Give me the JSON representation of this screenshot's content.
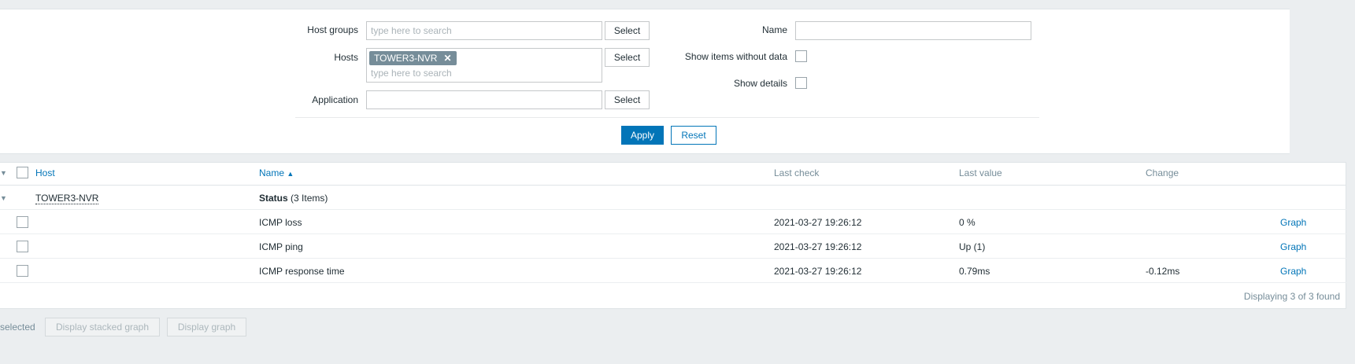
{
  "filter": {
    "host_groups_label": "Host groups",
    "host_groups_placeholder": "type here to search",
    "hosts_label": "Hosts",
    "hosts_tag": "TOWER3-NVR",
    "hosts_placeholder": "type here to search",
    "application_label": "Application",
    "select_label": "Select",
    "name_label": "Name",
    "show_items_without_data_label": "Show items without data",
    "show_details_label": "Show details",
    "apply_label": "Apply",
    "reset_label": "Reset"
  },
  "table": {
    "headers": {
      "host": "Host",
      "name": "Name",
      "name_sort_arrow": "▲",
      "last_check": "Last check",
      "last_value": "Last value",
      "change": "Change"
    },
    "group": {
      "host": "TOWER3-NVR",
      "application": "Status",
      "count": "(3 Items)"
    },
    "rows": [
      {
        "name": "ICMP loss",
        "last_check": "2021-03-27 19:26:12",
        "last_value": "0 %",
        "change": "",
        "action": "Graph"
      },
      {
        "name": "ICMP ping",
        "last_check": "2021-03-27 19:26:12",
        "last_value": "Up (1)",
        "change": "",
        "action": "Graph"
      },
      {
        "name": "ICMP response time",
        "last_check": "2021-03-27 19:26:12",
        "last_value": "0.79ms",
        "change": "-0.12ms",
        "action": "Graph"
      }
    ],
    "paging_text": "Displaying 3 of 3 found"
  },
  "footer": {
    "selected_text": "selected",
    "display_stacked_graph": "Display stacked graph",
    "display_graph": "Display graph"
  }
}
